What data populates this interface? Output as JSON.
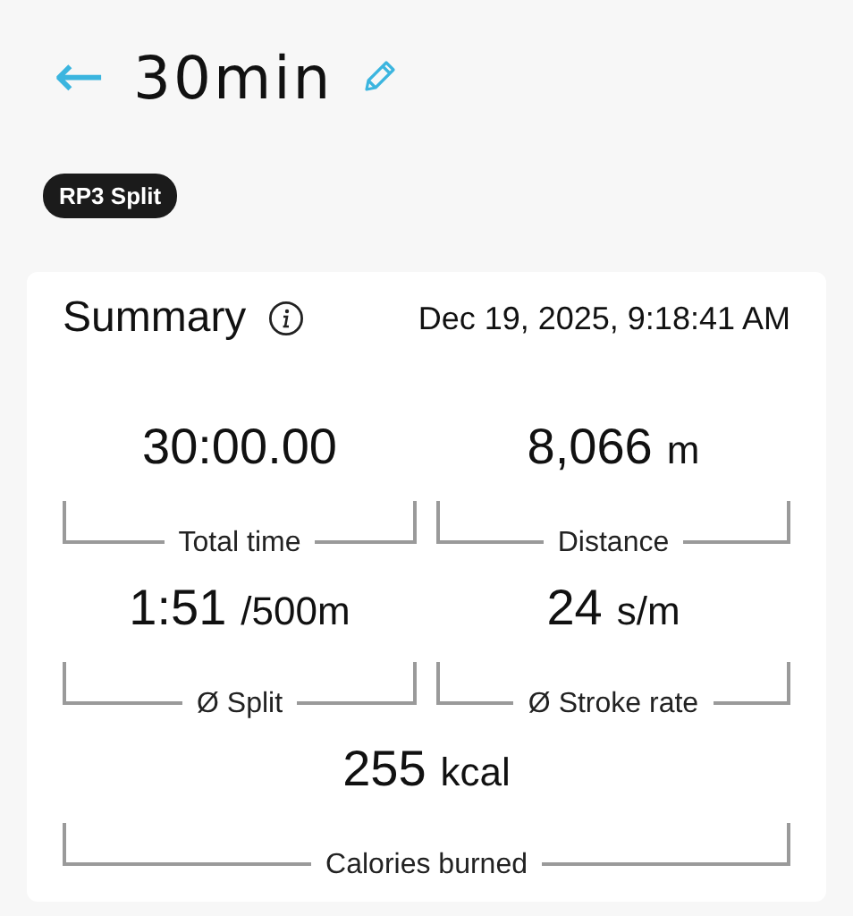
{
  "header": {
    "back": "←",
    "title": "30min"
  },
  "badge": "RP3 Split",
  "summary": {
    "title": "Summary",
    "date": "Dec 19, 2025, 9:18:41 AM",
    "rows": [
      [
        {
          "value": "30:00.00",
          "label": "Total time"
        },
        {
          "value": "8,066",
          "unit": "m",
          "label": "Distance"
        }
      ],
      [
        {
          "value": "1:51",
          "unit": "/500m",
          "label": "Ø Split"
        },
        {
          "value": "24",
          "unit": "s/m",
          "label": "Ø Stroke rate"
        }
      ],
      [
        {
          "value": "255",
          "unit": "kcal",
          "label": "Calories burned"
        }
      ]
    ]
  }
}
